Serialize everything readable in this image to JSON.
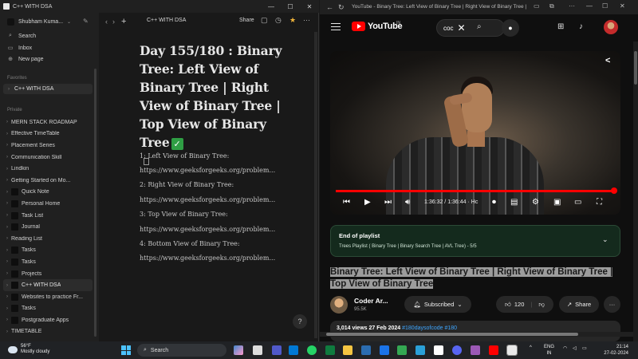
{
  "notion": {
    "window_title": "C++ WITH DSA",
    "workspace": "Shubham Kuma...",
    "nav": {
      "search": "Search",
      "inbox": "Inbox",
      "new_page": "New page"
    },
    "favorites_label": "Favorites",
    "favorite": "C++ WITH DSA",
    "private_label": "Private",
    "pages": [
      "MERN STACK ROADMAP",
      "Effective TimeTable",
      "Placement Series",
      "Communication Skill",
      "Lindkin",
      "Getting Started on Mo...",
      "Quick Note",
      "Personal Home",
      "Task List",
      "Journal",
      "Reading List",
      "Tasks",
      "Tasks",
      "Projects",
      "C++ WITH DSA",
      "Websites to practice Fr...",
      "Tasks",
      "Postgraduate Apps",
      "TIMETABLE"
    ],
    "breadcrumb": "C++ WITH DSA",
    "share": "Share",
    "doc_title": "Day 155/180 : Binary Tree: Left View of Binary Tree | Right View of Binary Tree | Top View of Binary Tree",
    "doc_check": "✓",
    "lines": [
      "1: Left View of Binary Tree:",
      "https://www.geeksforgeeks.org/problem...",
      "2: Right View of Binary Tree:",
      "https://www.geeksforgeeks.org/problem...",
      "3: Top View of Binary Tree:",
      "https://www.geeksforgeeks.org/problem...",
      "4: Bottom View of Binary Tree:",
      "https://www.geeksforgeeks.org/problem..."
    ],
    "help": "?"
  },
  "youtube": {
    "tab_title": "YouTube - Binary Tree: Left View of Binary Tree | Right View of Binary Tree | To...",
    "logo": "YouTube",
    "region": "IN",
    "search_query": "coc",
    "player": {
      "time": "1:36:32 / 1:36:44 · Hc",
      "progress_fraction": 0.998
    },
    "playlist": {
      "title": "End of playlist",
      "subtitle": "Trees Playlist ( Binary Tree | Binary Search Tree | AVL Tree) - 5/5"
    },
    "video_title": "Binary Tree: Left View of Binary Tree | Right View of Binary Tree | Top View of Binary Tree",
    "channel": {
      "name": "Coder Ar...",
      "subs": "95.5K"
    },
    "subscribed": "Subscribed",
    "likes": "120",
    "share": "Share",
    "more": "···",
    "description": {
      "views": "3,014 views 27 Feb 2024",
      "tags": "#180daysofcode #180"
    }
  },
  "taskbar": {
    "weather_temp": "56°F",
    "weather_desc": "Mostly cloudy",
    "search": "Search",
    "lang1": "ENG",
    "lang2": "IN",
    "time": "21:14",
    "date": "27-02-2024"
  }
}
